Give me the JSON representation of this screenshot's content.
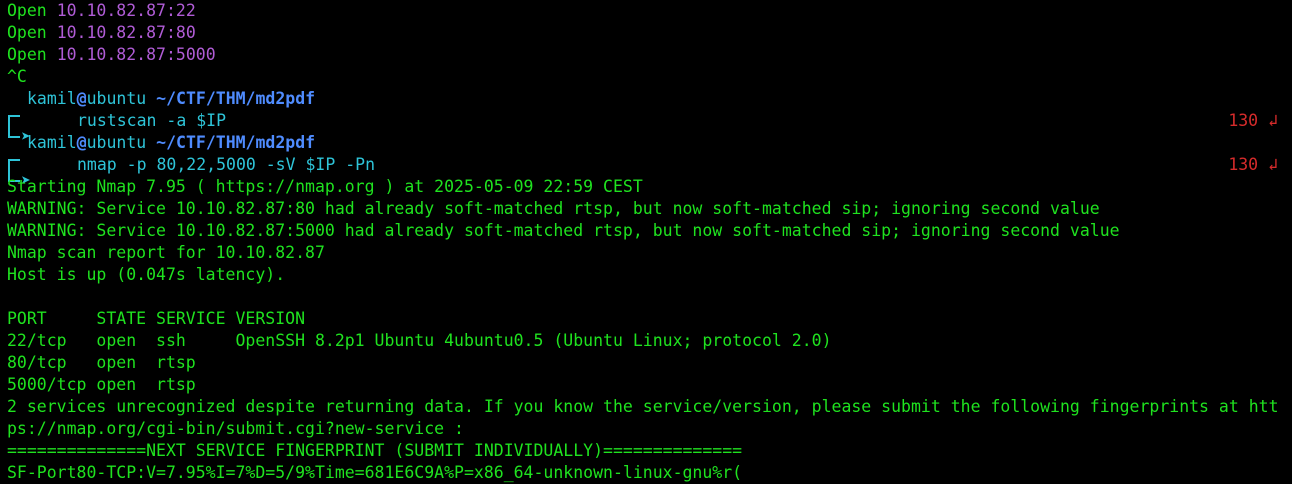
{
  "terminal": {
    "scan_lines": [
      {
        "label": "Open",
        "addr": "10.10.82.87:22"
      },
      {
        "label": "Open",
        "addr": "10.10.82.87:80"
      },
      {
        "label": "Open",
        "addr": "10.10.82.87:5000"
      }
    ],
    "interrupt": "^C",
    "prompts": [
      {
        "user": "kamil",
        "at": "@",
        "host": "ubuntu",
        "path": "~/CTF/THM/md2pdf",
        "arrow": "➤",
        "command": "rustscan -a $IP",
        "exit_code": "130",
        "exit_symbol": "↲"
      },
      {
        "user": "kamil",
        "at": "@",
        "host": "ubuntu",
        "path": "~/CTF/THM/md2pdf",
        "arrow": "➤",
        "command": "nmap -p 80,22,5000 -sV $IP -Pn",
        "exit_code": "130",
        "exit_symbol": "↲"
      }
    ],
    "output": [
      "Starting Nmap 7.95 ( https://nmap.org ) at 2025-05-09 22:59 CEST",
      "WARNING: Service 10.10.82.87:80 had already soft-matched rtsp, but now soft-matched sip; ignoring second value",
      "WARNING: Service 10.10.82.87:5000 had already soft-matched rtsp, but now soft-matched sip; ignoring second value",
      "Nmap scan report for 10.10.82.87",
      "Host is up (0.047s latency).",
      "",
      "PORT     STATE SERVICE VERSION",
      "22/tcp   open  ssh     OpenSSH 8.2p1 Ubuntu 4ubuntu0.5 (Ubuntu Linux; protocol 2.0)",
      "80/tcp   open  rtsp",
      "5000/tcp open  rtsp",
      "2 services unrecognized despite returning data. If you know the service/version, please submit the following fingerprints at htt",
      "ps://nmap.org/cgi-bin/submit.cgi?new-service :",
      "==============NEXT SERVICE FINGERPRINT (SUBMIT INDIVIDUALLY)==============",
      "SF-Port80-TCP:V=7.95%I=7%D=5/9%Time=681E6C9A%P=x86_64-unknown-linux-gnu%r("
    ],
    "colors": {
      "background": "#000000",
      "output_green": "#1fe21f",
      "address_purple": "#b05cd6",
      "path_blue": "#4f8cff",
      "prompt_cyan": "#2ec4d8",
      "exit_red": "#d62b2b"
    }
  }
}
